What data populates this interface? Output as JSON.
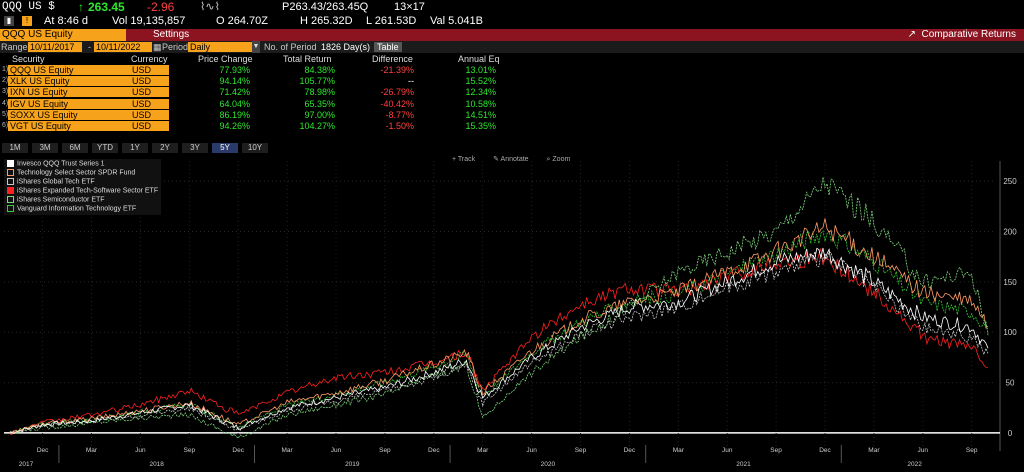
{
  "quote": {
    "ticker": "QQQ US $",
    "last": "263.45",
    "change": "-2.96",
    "bid_ask": "P263.43/263.45Q",
    "size": "13×17",
    "time": "At 8:46 d",
    "vol": "Vol 19,135,857",
    "open": "O 264.70Z",
    "high": "H 265.32D",
    "low": "L 261.53D",
    "val": "Val 5.041B"
  },
  "tabs": {
    "security": "QQQ US Equity",
    "settings": "Settings",
    "comparative": "Comparative Returns"
  },
  "range": {
    "label": "Range",
    "start": "10/11/2017",
    "sep": "-",
    "end": "10/11/2022",
    "period_label": "Period",
    "period": "Daily",
    "nop_label": "No. of Period",
    "nop_value": "1826 Day(s)",
    "table_btn": "Table"
  },
  "table": {
    "headers": [
      "Security",
      "Currency",
      "Price Change",
      "Total Return",
      "Difference",
      "Annual Eq"
    ],
    "rows": [
      {
        "num": "1)",
        "security": "QQQ US Equity",
        "currency": "USD",
        "price_change": "77.93%",
        "total_return": "84.38%",
        "difference": "-21.39%",
        "annual_eq": "13.01%"
      },
      {
        "num": "2)",
        "security": "XLK US Equity",
        "currency": "USD",
        "price_change": "94.14%",
        "total_return": "105.77%",
        "difference": "--",
        "annual_eq": "15.52%"
      },
      {
        "num": "3)",
        "security": "IXN US Equity",
        "currency": "USD",
        "price_change": "71.42%",
        "total_return": "78.98%",
        "difference": "-26.79%",
        "annual_eq": "12.34%"
      },
      {
        "num": "4)",
        "security": "IGV US Equity",
        "currency": "USD",
        "price_change": "64.04%",
        "total_return": "65.35%",
        "difference": "-40.42%",
        "annual_eq": "10.58%"
      },
      {
        "num": "5)",
        "security": "SOXX US Equity",
        "currency": "USD",
        "price_change": "86.19%",
        "total_return": "97.00%",
        "difference": "-8.77%",
        "annual_eq": "14.51%"
      },
      {
        "num": "6)",
        "security": "VGT US Equity",
        "currency": "USD",
        "price_change": "94.26%",
        "total_return": "104.27%",
        "difference": "-1.50%",
        "annual_eq": "15.35%"
      }
    ]
  },
  "periods": [
    "1M",
    "3M",
    "6M",
    "YTD",
    "1Y",
    "2Y",
    "3Y",
    "5Y",
    "10Y"
  ],
  "active_period": "5Y",
  "tools": {
    "track": "Track",
    "annotate": "Annotate",
    "zoom": "Zoom"
  },
  "colors": {
    "accent": "#f6a21a",
    "tabbar": "#8c1420",
    "up": "#2ee62e",
    "down": "#ff4040"
  },
  "chart_data": {
    "type": "line",
    "title": "",
    "ylim": [
      -10,
      270
    ],
    "yticks": [
      0,
      50,
      100,
      150,
      200,
      250
    ],
    "x_month_labels": [
      "Dec",
      "Mar",
      "Jun",
      "Sep",
      "Dec",
      "Mar",
      "Jun",
      "Sep",
      "Dec",
      "Mar",
      "Jun",
      "Sep",
      "Dec",
      "Mar",
      "Jun",
      "Sep",
      "Dec",
      "Mar",
      "Jun",
      "Sep"
    ],
    "x_year_labels": [
      "2017",
      "2018",
      "2019",
      "2020",
      "2021",
      "2022"
    ],
    "x": [
      "2017-10",
      "2017-12",
      "2018-03",
      "2018-06",
      "2018-09",
      "2018-12",
      "2019-03",
      "2019-06",
      "2019-09",
      "2019-12",
      "2020-02",
      "2020-03",
      "2020-06",
      "2020-09",
      "2020-12",
      "2021-03",
      "2021-06",
      "2021-09",
      "2021-12",
      "2022-03",
      "2022-06",
      "2022-09",
      "2022-10"
    ],
    "series": [
      {
        "name": "Invesco QQQ Trust Series 1",
        "color": "#ffffff",
        "values": [
          0,
          8,
          12,
          20,
          28,
          5,
          25,
          35,
          45,
          60,
          72,
          35,
          75,
          105,
          125,
          130,
          150,
          170,
          180,
          150,
          115,
          105,
          84
        ]
      },
      {
        "name": "Technology Select Sector SPDR Fund",
        "color": "#ff9a66",
        "values": [
          0,
          9,
          14,
          22,
          30,
          8,
          30,
          40,
          52,
          68,
          80,
          40,
          82,
          112,
          130,
          140,
          160,
          180,
          205,
          175,
          140,
          130,
          106
        ]
      },
      {
        "name": "iShares Global Tech ETF",
        "color": "#c8c8c8",
        "values": [
          0,
          8,
          12,
          18,
          24,
          4,
          22,
          32,
          42,
          55,
          66,
          30,
          70,
          98,
          115,
          125,
          145,
          160,
          175,
          145,
          105,
          95,
          79
        ]
      },
      {
        "name": "iShares Expanded Tech-Software Sector ETF",
        "color": "#ff2020",
        "values": [
          0,
          10,
          18,
          28,
          42,
          18,
          40,
          55,
          60,
          70,
          80,
          42,
          95,
          128,
          145,
          140,
          155,
          170,
          175,
          140,
          95,
          85,
          65
        ]
      },
      {
        "name": "iShares Semiconductor ETF",
        "color": "#7fd97f",
        "values": [
          0,
          5,
          10,
          15,
          18,
          -5,
          18,
          28,
          38,
          58,
          68,
          15,
          60,
          95,
          125,
          160,
          180,
          200,
          250,
          210,
          150,
          160,
          97
        ]
      },
      {
        "name": "Vanguard Information Technology ETF",
        "color": "#33cc33",
        "values": [
          0,
          9,
          13,
          21,
          28,
          6,
          27,
          38,
          50,
          66,
          78,
          36,
          80,
          110,
          130,
          138,
          158,
          178,
          200,
          170,
          130,
          120,
          104
        ]
      }
    ]
  }
}
